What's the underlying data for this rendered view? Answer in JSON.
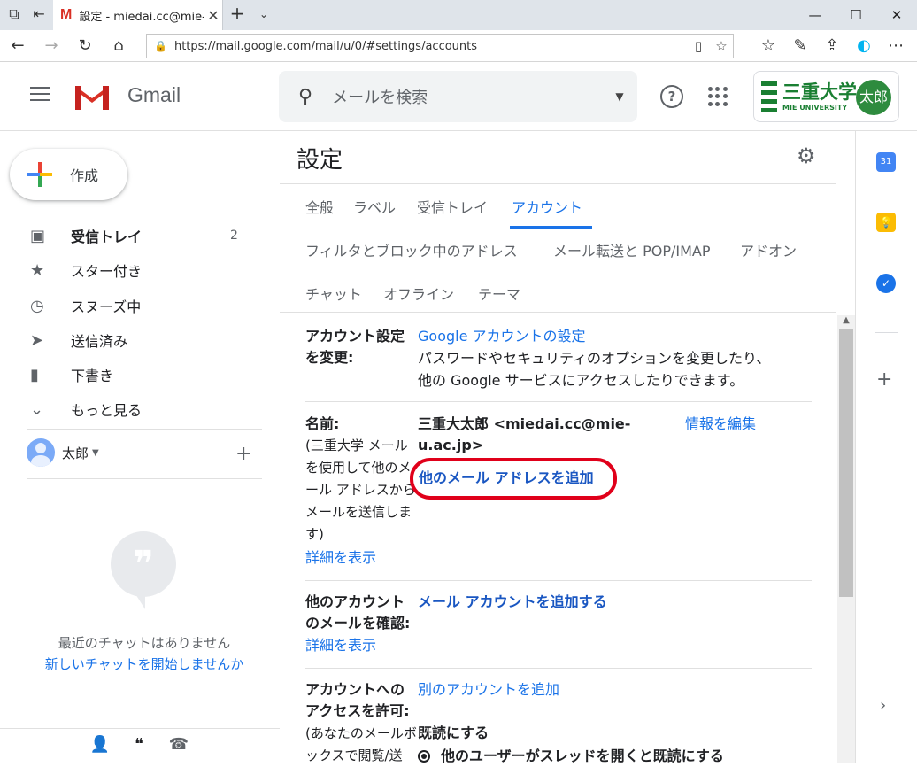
{
  "browser": {
    "tab_title": "設定 - miedai.cc@mie-u",
    "tab_icon": "gmail-m-icon",
    "url": "https://mail.google.com/mail/u/0/#settings/accounts"
  },
  "header": {
    "app_name": "Gmail",
    "search_placeholder": "メールを検索",
    "org_name": "三重大学",
    "org_sub": "MIE UNIVERSITY",
    "avatar_text": "太郎"
  },
  "sidebar": {
    "compose": "作成",
    "items": [
      {
        "label": "受信トレイ",
        "count": "2",
        "icon": "inbox-icon"
      },
      {
        "label": "スター付き",
        "count": "",
        "icon": "star-icon"
      },
      {
        "label": "スヌーズ中",
        "count": "",
        "icon": "clock-icon"
      },
      {
        "label": "送信済み",
        "count": "",
        "icon": "send-icon"
      },
      {
        "label": "下書き",
        "count": "",
        "icon": "draft-icon"
      },
      {
        "label": "もっと見る",
        "count": "",
        "icon": "chevron-down-icon"
      }
    ],
    "hangouts_user": "太郎",
    "no_chats": "最近のチャットはありません",
    "start_chat": "新しいチャットを開始しませんか"
  },
  "settings": {
    "title": "設定",
    "tabs_row1": [
      "全般",
      "ラベル",
      "受信トレイ",
      "アカウント"
    ],
    "tabs_row2": [
      "フィルタとブロック中のアドレス",
      "メール転送と POP/IMAP",
      "アドオン"
    ],
    "tabs_row3": [
      "チャット",
      "オフライン",
      "テーマ"
    ],
    "active_tab": "アカウント",
    "section_account": {
      "label_line1": "アカウント設定",
      "label_line2": "を変更:",
      "link": "Google アカウントの設定",
      "desc_line1": "パスワードやセキュリティのオプションを変更したり、",
      "desc_line2": "他の Google サービスにアクセスしたりできます。"
    },
    "section_name": {
      "label": "名前:",
      "sub_lines": [
        "(三重大学 メール",
        "を使用して他のメ",
        "ール アドレスから",
        "メールを送信しま",
        "す)"
      ],
      "detail_link": "詳細を表示",
      "value_line1": "三重大太郎 <miedai.cc@mie-",
      "value_line2": "u.ac.jp>",
      "edit_link": "情報を編集",
      "add_address_link": "他のメール アドレスを追加"
    },
    "section_check": {
      "label_line1": "他のアカウント",
      "label_line2": "のメールを確認:",
      "link": "メール アカウントを追加する",
      "detail_link": "詳細を表示"
    },
    "section_grant": {
      "label_line1": "アカウントへの",
      "label_line2": "アクセスを許可:",
      "sub_line1": "(あなたのメールボ",
      "sub_line2": "ックスで閲覧/送",
      "link": "別のアカウントを追加",
      "mark_read": "既読にする",
      "radio_option": "他のユーザーがスレッドを開くと既読にする"
    }
  }
}
